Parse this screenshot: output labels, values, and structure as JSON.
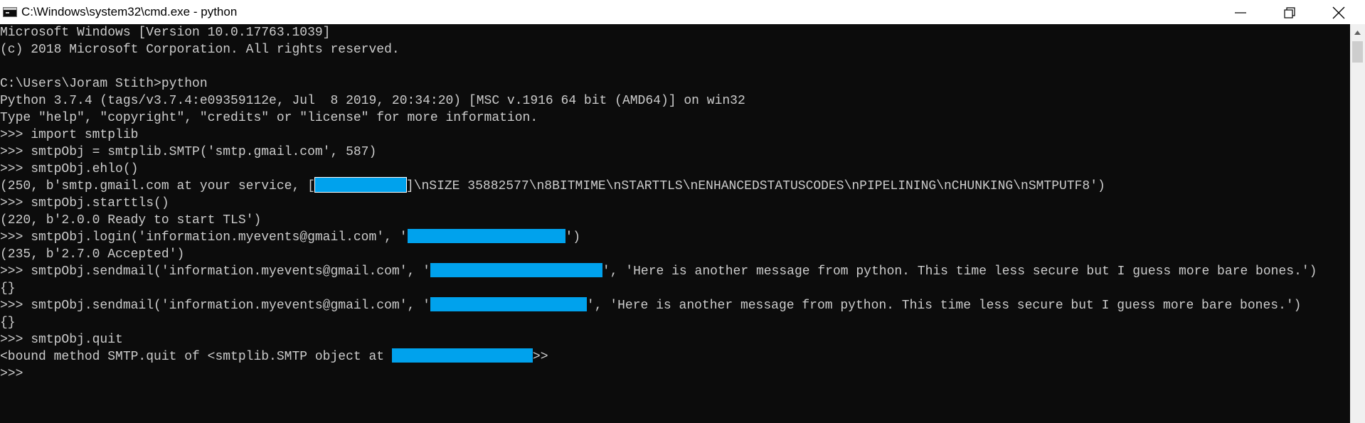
{
  "window": {
    "title": "C:\\Windows\\system32\\cmd.exe - python",
    "icons": {
      "app": "cmd-icon",
      "minimize": "minimize-icon",
      "maximize": "restore-icon",
      "close": "close-icon"
    }
  },
  "colors": {
    "console_bg": "#0c0c0c",
    "console_text": "#cccccc",
    "redaction": "#00a2ed",
    "titlebar_bg": "#ffffff"
  },
  "console": {
    "lines": [
      [
        {
          "t": "Microsoft Windows [Version 10.0.17763.1039]"
        }
      ],
      [
        {
          "t": "(c) 2018 Microsoft Corporation. All rights reserved."
        }
      ],
      [
        {
          "t": ""
        }
      ],
      [
        {
          "t": "C:\\Users\\Joram Stith>python"
        }
      ],
      [
        {
          "t": "Python 3.7.4 (tags/v3.7.4:e09359112e, Jul  8 2019, 20:34:20) [MSC v.1916 64 bit (AMD64)] on win32"
        }
      ],
      [
        {
          "t": "Type \"help\", \"copyright\", \"credits\" or \"license\" for more information."
        }
      ],
      [
        {
          "t": ">>> import smtplib"
        }
      ],
      [
        {
          "t": ">>> smtpObj = smtplib.SMTP('smtp.gmail.com', 587)"
        }
      ],
      [
        {
          "t": ">>> smtpObj.ehlo()"
        }
      ],
      [
        {
          "t": "(250, b'smtp.gmail.com at your service, ["
        },
        {
          "r": 128,
          "boxed": true
        },
        {
          "t": "]\\nSIZE 35882577\\n8BITMIME\\nSTARTTLS\\nENHANCEDSTATUSCODES\\nPIPELINING\\nCHUNKING\\nSMTPUTF8')"
        }
      ],
      [
        {
          "t": ">>> smtpObj.starttls()"
        }
      ],
      [
        {
          "t": "(220, b'2.0.0 Ready to start TLS')"
        }
      ],
      [
        {
          "t": ">>> smtpObj.login('information.myevents@gmail.com', '"
        },
        {
          "r": 222
        },
        {
          "t": "')"
        }
      ],
      [
        {
          "t": "(235, b'2.7.0 Accepted')"
        }
      ],
      [
        {
          "t": ">>> smtpObj.sendmail('information.myevents@gmail.com', '"
        },
        {
          "r": 242
        },
        {
          "t": "', 'Here is another message from python. This time less secure but I guess more bare bones.')"
        }
      ],
      [
        {
          "t": "{}"
        }
      ],
      [
        {
          "t": ">>> smtpObj.sendmail('information.myevents@gmail.com', '"
        },
        {
          "r": 220
        },
        {
          "t": "', 'Here is another message from python. This time less secure but I guess more bare bones.')"
        }
      ],
      [
        {
          "t": "{}"
        }
      ],
      [
        {
          "t": ">>> smtpObj.quit"
        }
      ],
      [
        {
          "t": "<bound method SMTP.quit of <smtplib.SMTP object at "
        },
        {
          "r": 198
        },
        {
          "t": ">>"
        }
      ],
      [
        {
          "t": ">>>"
        }
      ]
    ]
  }
}
